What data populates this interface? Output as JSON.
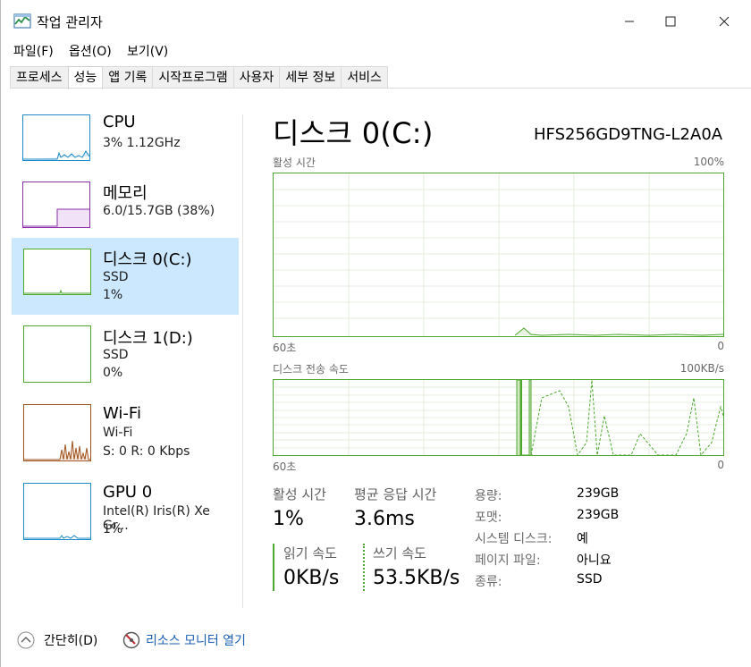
{
  "window": {
    "title": "작업 관리자",
    "buttons": {
      "minimize": "—",
      "maximize": "☐",
      "close": "✕"
    }
  },
  "menu": [
    "파일(F)",
    "옵션(O)",
    "보기(V)"
  ],
  "tabs": [
    "프로세스",
    "성능",
    "앱 기록",
    "시작프로그램",
    "사용자",
    "세부 정보",
    "서비스"
  ],
  "active_tab": "성능",
  "sidebar": [
    {
      "name": "CPU",
      "line1": "3% 1.12GHz",
      "line2": "",
      "color": "#1e8bc8"
    },
    {
      "name": "메모리",
      "line1": "6.0/15.7GB (38%)",
      "line2": "",
      "color": "#8b2fa8"
    },
    {
      "name": "디스크 0(C:)",
      "line1": "SSD",
      "line2": "1%",
      "color": "#4ea72e",
      "selected": true
    },
    {
      "name": "디스크 1(D:)",
      "line1": "SSD",
      "line2": "0%",
      "color": "#4ea72e"
    },
    {
      "name": "Wi-Fi",
      "line1": "Wi-Fi",
      "line2": "S: 0 R: 0 Kbps",
      "color": "#a0521e"
    },
    {
      "name": "GPU 0",
      "line1": "Intel(R) Iris(R) Xe Gr...",
      "line2": "1%",
      "color": "#1e8bc8"
    }
  ],
  "main": {
    "title": "디스크 0(C:)",
    "model": "HFS256GD9TNG-L2A0A",
    "graph1": {
      "label": "활성 시간",
      "max": "100%",
      "time": "60초",
      "min": "0"
    },
    "graph2": {
      "label": "디스크 전송 속도",
      "max": "100KB/s",
      "time": "60초",
      "min": "0"
    },
    "stats": {
      "active_label": "활성 시간",
      "active_value": "1%",
      "resp_label": "평균 응답 시간",
      "resp_value": "3.6ms",
      "read_label": "읽기 속도",
      "read_value": "0KB/s",
      "write_label": "쓰기 속도",
      "write_value": "53.5KB/s"
    },
    "props": [
      {
        "label": "용량:",
        "value": "239GB"
      },
      {
        "label": "포맷:",
        "value": "239GB"
      },
      {
        "label": "시스템 디스크:",
        "value": "예"
      },
      {
        "label": "페이지 파일:",
        "value": "아니요"
      },
      {
        "label": "종류:",
        "value": "SSD"
      }
    ]
  },
  "footer": {
    "collapse": "간단히(D)",
    "resmon": "리소스 모니터 열기"
  }
}
